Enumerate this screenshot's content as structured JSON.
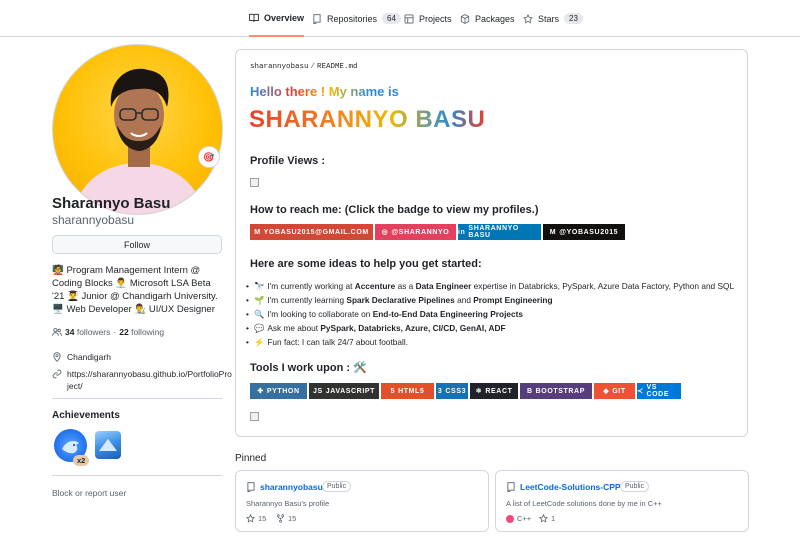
{
  "nav": {
    "tabs": [
      {
        "label": "Overview",
        "icon": "book-icon",
        "active": true
      },
      {
        "label": "Repositories",
        "icon": "repo-icon",
        "count": "64"
      },
      {
        "label": "Projects",
        "icon": "table-icon"
      },
      {
        "label": "Packages",
        "icon": "package-icon"
      },
      {
        "label": "Stars",
        "icon": "star-icon",
        "count": "23"
      }
    ]
  },
  "profile": {
    "full_name": "Sharannyo Basu",
    "username": "sharannyobasu",
    "follow_label": "Follow",
    "status_emoji": "🎯",
    "bio": "🧑‍🏫 Program Management Intern @ Coding Blocks 👨‍💼 Microsoft LSA Beta '21 👨‍🎓 Junior @ Chandigarh University. 🖥️ Web Developer 👨‍🎨 UI/UX Designer",
    "followers_count": "34",
    "followers_label": "followers",
    "dot": "·",
    "following_count": "22",
    "following_label": "following",
    "location": "Chandigarh",
    "website_line1": "https://sharannyobasu.github.io/PortfolioPro",
    "website_line2": "ject/",
    "achievements_title": "Achievements",
    "achievement_count": "x2",
    "block_label": "Block or report user"
  },
  "readme": {
    "owner": "sharannyobasu",
    "slash": "/",
    "file": "README.md",
    "hello": "Hello there ! My name is",
    "name_banner": "SHARANNYO BASU",
    "views_heading": "Profile Views :",
    "reach_heading": "How to reach me: (Click the badge to view my profiles.)",
    "contact_badges": [
      {
        "label": "YOBASU2015@GMAIL.COM",
        "icon": "gmail-icon",
        "color": "#d14836"
      },
      {
        "label": "@SHARANNYO",
        "icon": "instagram-icon",
        "color": "#e4405f"
      },
      {
        "label": "SHARANNYO BASU",
        "icon": "linkedin-icon",
        "color": "#0077b5"
      },
      {
        "label": "@YOBASU2015",
        "icon": "medium-icon",
        "color": "#12100e"
      }
    ],
    "ideas_heading": "Here are some ideas to help you get started:",
    "ideas": [
      {
        "emoji": "🔭",
        "pre": "I'm currently working at ",
        "b1": "Accenture",
        "mid": " as a ",
        "b2": "Data Engineer",
        "post": " expertise in Databricks, PySpark, Azure Data Factory, Python and SQL"
      },
      {
        "emoji": "🌱",
        "pre": "I'm currently learning ",
        "b1": "Spark Declarative Pipelines",
        "mid": " and ",
        "b2": "Prompt Engineering",
        "post": ""
      },
      {
        "emoji": "🔍",
        "pre": "I'm looking to collaborate on ",
        "b1": "End-to-End Data Engineering Projects",
        "mid": "",
        "b2": "",
        "post": ""
      },
      {
        "emoji": "💬",
        "pre": "Ask me about ",
        "b1": "PySpark, Databricks, Azure, CI/CD, GenAI, ADF",
        "mid": "",
        "b2": "",
        "post": ""
      },
      {
        "emoji": "⚡",
        "pre": "Fun fact: I can talk 24/7 about football.",
        "b1": "",
        "mid": "",
        "b2": "",
        "post": ""
      }
    ],
    "tools_heading": "Tools I work upon : 🛠️",
    "tool_badges": [
      {
        "label": "PYTHON",
        "icon": "python-icon",
        "color": "#3670a0"
      },
      {
        "label": "JAVASCRIPT",
        "icon": "javascript-icon",
        "color": "#323330"
      },
      {
        "label": "HTML5",
        "icon": "html5-icon",
        "color": "#e34f26"
      },
      {
        "label": "CSS3",
        "icon": "css3-icon",
        "color": "#1572b6"
      },
      {
        "label": "REACT",
        "icon": "react-icon",
        "color": "#20232a"
      },
      {
        "label": "BOOTSTRAP",
        "icon": "bootstrap-icon",
        "color": "#563d7c"
      },
      {
        "label": "GIT",
        "icon": "git-icon",
        "color": "#f05033"
      },
      {
        "label": "VS CODE",
        "icon": "vscode-icon",
        "color": "#0078d7"
      }
    ]
  },
  "pinned": {
    "title": "Pinned",
    "repos": [
      {
        "name": "sharannyobasu",
        "visibility": "Public",
        "description": "Sharannyo Basu's profile",
        "stars": "15",
        "forks": "15"
      },
      {
        "name": "LeetCode-Solutions-CPP",
        "visibility": "Public",
        "description": "A list of LeetCode solutions done by me in C++",
        "language": "C++",
        "language_color": "#f34b7d",
        "stars": "1"
      }
    ]
  }
}
